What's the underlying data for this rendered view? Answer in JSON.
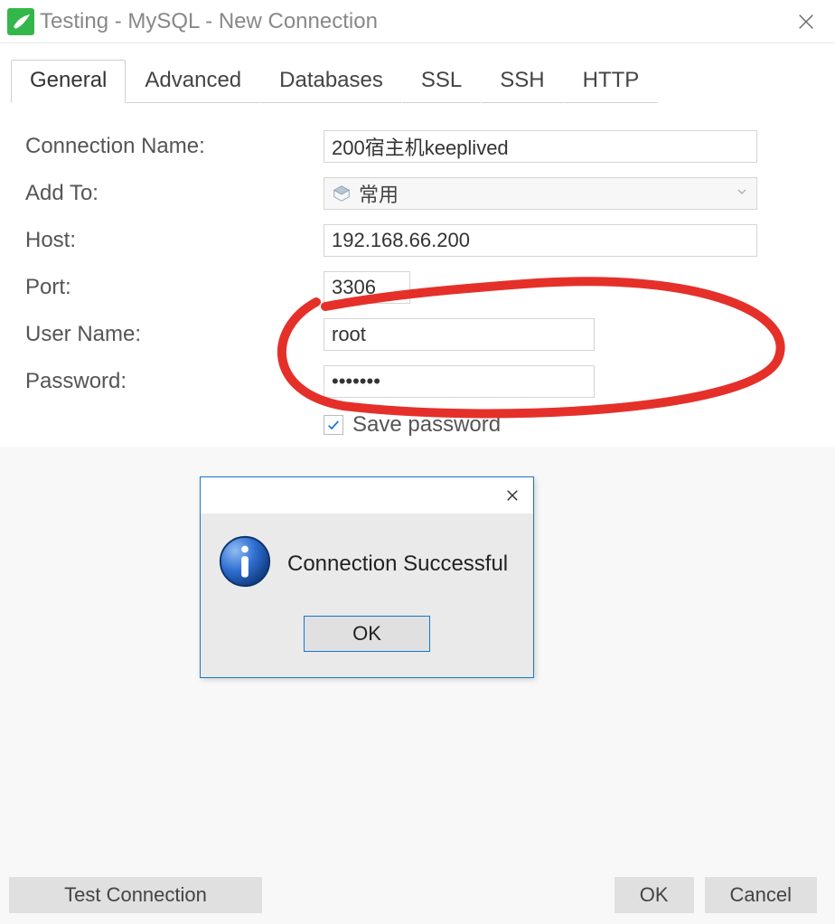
{
  "window": {
    "title": "Testing - MySQL - New Connection"
  },
  "tabs": {
    "active_index": 0,
    "items": [
      {
        "label": "General"
      },
      {
        "label": "Advanced"
      },
      {
        "label": "Databases"
      },
      {
        "label": "SSL"
      },
      {
        "label": "SSH"
      },
      {
        "label": "HTTP"
      }
    ]
  },
  "form": {
    "connection_name": {
      "label": "Connection Name:",
      "value": "200宿主机keeplived"
    },
    "add_to": {
      "label": "Add To:",
      "value": "常用"
    },
    "host": {
      "label": "Host:",
      "value": "192.168.66.200"
    },
    "port": {
      "label": "Port:",
      "value": "3306"
    },
    "user_name": {
      "label": "User Name:",
      "value": "root"
    },
    "password": {
      "label": "Password:",
      "value": "•••••••"
    },
    "save_password": {
      "label": "Save password",
      "checked": true
    }
  },
  "dialog": {
    "message": "Connection Successful",
    "ok": "OK"
  },
  "footer": {
    "test": "Test Connection",
    "ok": "OK",
    "cancel": "Cancel"
  }
}
